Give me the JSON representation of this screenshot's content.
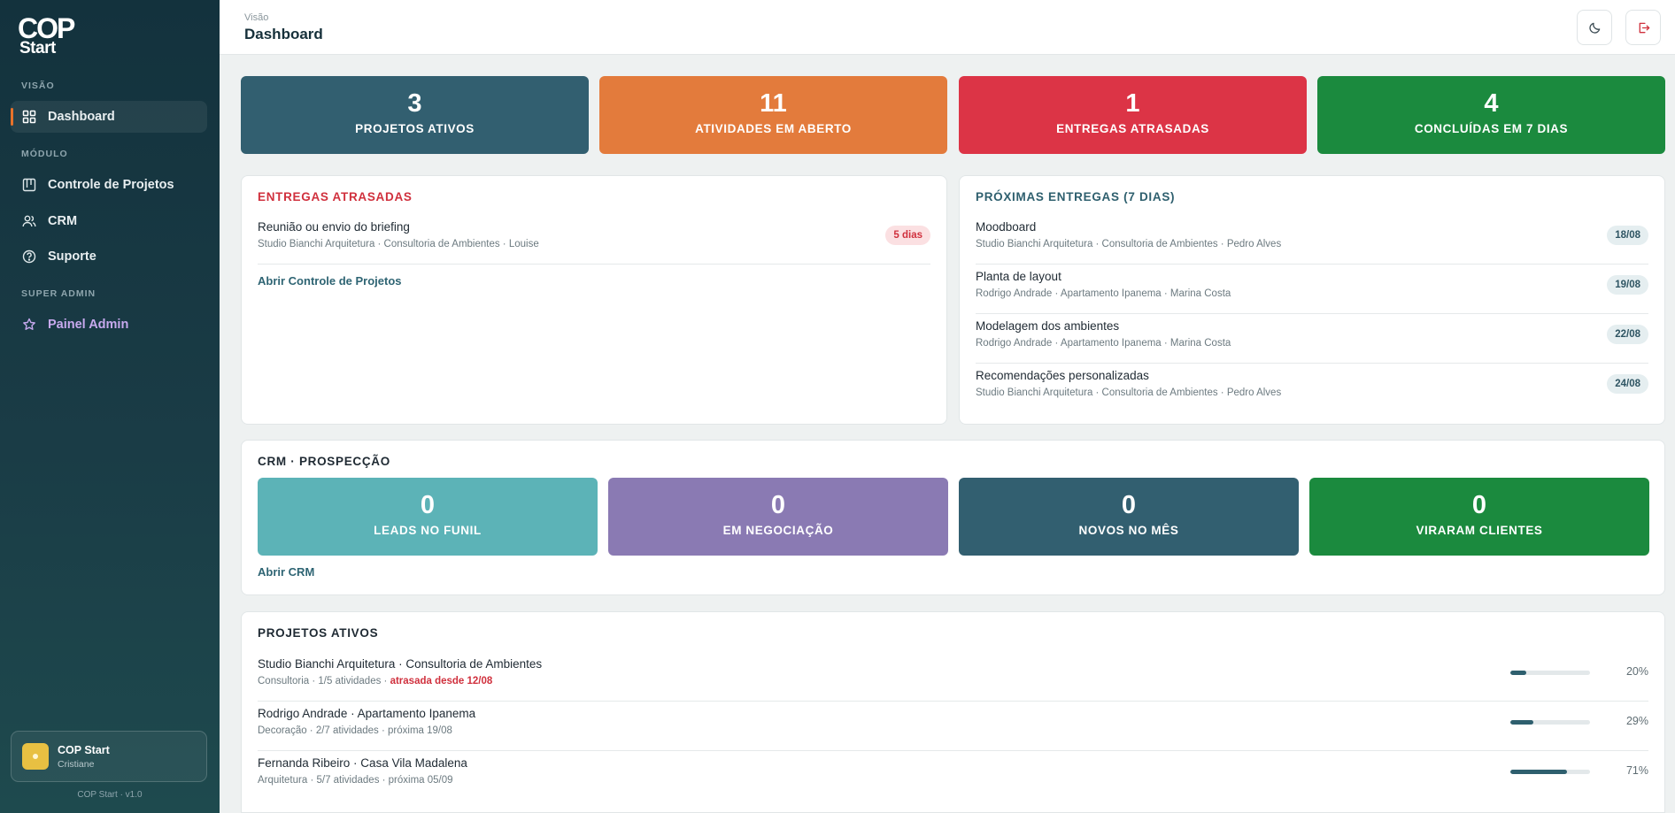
{
  "sidebar": {
    "logo": {
      "line1": "COP",
      "line2": "Start"
    },
    "sections": {
      "visao": "VISÃO",
      "modulo": "MÓDULO",
      "super_admin": "SUPER ADMIN"
    },
    "items": {
      "dashboard": "Dashboard",
      "controle": "Controle de Projetos",
      "crm": "CRM",
      "suporte": "Suporte",
      "admin": "Painel Admin"
    },
    "user": {
      "name": "COP Start",
      "sub": "Cristiane"
    },
    "version": "COP Start · v1.0"
  },
  "header": {
    "crumb": "Visão",
    "title": "Dashboard",
    "theme_icon": "moon-icon",
    "logout_icon": "logout-icon"
  },
  "stats": [
    {
      "value": "3",
      "label": "PROJETOS ATIVOS",
      "color": "#325f70"
    },
    {
      "value": "11",
      "label": "ATIVIDADES EM ABERTO",
      "color": "#e37b3c"
    },
    {
      "value": "1",
      "label": "ENTREGAS ATRASADAS",
      "color": "#dc3446"
    },
    {
      "value": "4",
      "label": "CONCLUÍDAS EM 7 DIAS",
      "color": "#1b8a3e"
    }
  ],
  "late": {
    "title": "ENTREGAS ATRASADAS",
    "items": [
      {
        "title": "Reunião ou envio do briefing",
        "sub": "Studio Bianchi Arquitetura · Consultoria de Ambientes · Louise",
        "badge": "5 dias"
      }
    ],
    "link": "Abrir Controle de Projetos"
  },
  "next": {
    "title": "PRÓXIMAS ENTREGAS (7 DIAS)",
    "items": [
      {
        "title": "Moodboard",
        "sub": "Studio Bianchi Arquitetura · Consultoria de Ambientes · Pedro Alves",
        "date": "18/08"
      },
      {
        "title": "Planta de layout",
        "sub": "Rodrigo Andrade · Apartamento Ipanema · Marina Costa",
        "date": "19/08"
      },
      {
        "title": "Modelagem dos ambientes",
        "sub": "Rodrigo Andrade · Apartamento Ipanema · Marina Costa",
        "date": "22/08"
      },
      {
        "title": "Recomendações personalizadas",
        "sub": "Studio Bianchi Arquitetura · Consultoria de Ambientes · Pedro Alves",
        "date": "24/08"
      }
    ]
  },
  "crm": {
    "title": "CRM · PROSPECÇÃO",
    "cards": [
      {
        "value": "0",
        "label": "LEADS NO FUNIL",
        "color": "#5cb3b7"
      },
      {
        "value": "0",
        "label": "EM NEGOCIAÇÃO",
        "color": "#8a7ab3"
      },
      {
        "value": "0",
        "label": "NOVOS NO MÊS",
        "color": "#325f70"
      },
      {
        "value": "0",
        "label": "VIRARAM CLIENTES",
        "color": "#1b8a3e"
      }
    ],
    "link": "Abrir CRM"
  },
  "projects": {
    "title": "PROJETOS ATIVOS",
    "items": [
      {
        "title": "Studio Bianchi Arquitetura · Consultoria de Ambientes",
        "sub": "Consultoria · 1/5 atividades · ",
        "late": "atrasada desde 12/08",
        "progress": 20,
        "pct": "20%"
      },
      {
        "title": "Rodrigo Andrade · Apartamento Ipanema",
        "sub": "Decoração · 2/7 atividades · próxima 19/08",
        "late": "",
        "progress": 29,
        "pct": "29%"
      },
      {
        "title": "Fernanda Ribeiro · Casa Vila Madalena",
        "sub": "Arquitetura · 5/7 atividades · próxima 05/09",
        "late": "",
        "progress": 71,
        "pct": "71%"
      }
    ]
  },
  "colors": {
    "late_title": "#d0303d",
    "next_title": "#2e5f6e",
    "dark_title": "#1f2a33",
    "accent": "#e8722a"
  }
}
